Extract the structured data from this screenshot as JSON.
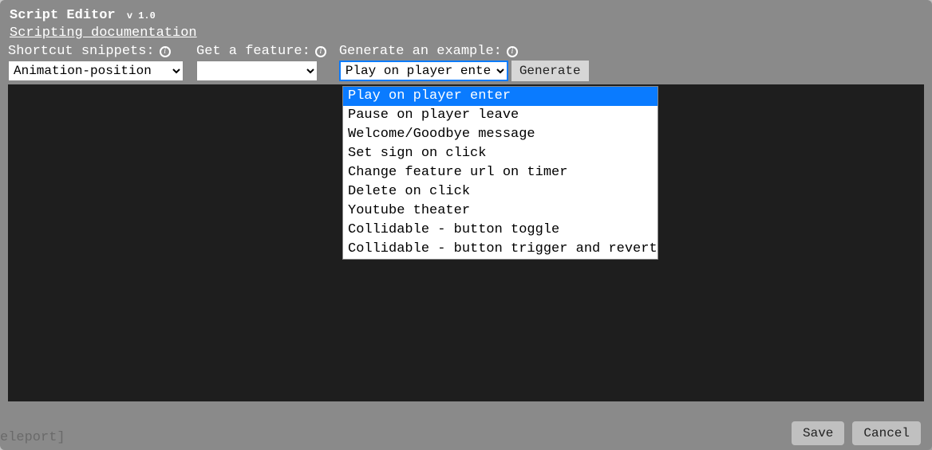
{
  "header": {
    "title": "Script Editor",
    "version": "v 1.0",
    "doc_link_label": "Scripting documentation"
  },
  "toolbar": {
    "snippet_label": "Shortcut snippets:",
    "snippet_selected": "Animation-position",
    "feature_label": "Get a feature:",
    "feature_selected": "",
    "example_label": "Generate an example:",
    "example_selected": "Play on player enter",
    "generate_label": "Generate"
  },
  "example_dropdown": {
    "options": [
      "Play on player enter",
      "Pause on player leave",
      "Welcome/Goodbye message",
      "Set sign on click",
      "Change feature url on timer",
      "Delete on click",
      "Youtube theater",
      "Collidable - button toggle",
      "Collidable - button trigger and revert"
    ],
    "selected_index": 0
  },
  "footer": {
    "corner_text": "eleport]",
    "save_label": "Save",
    "cancel_label": "Cancel"
  }
}
